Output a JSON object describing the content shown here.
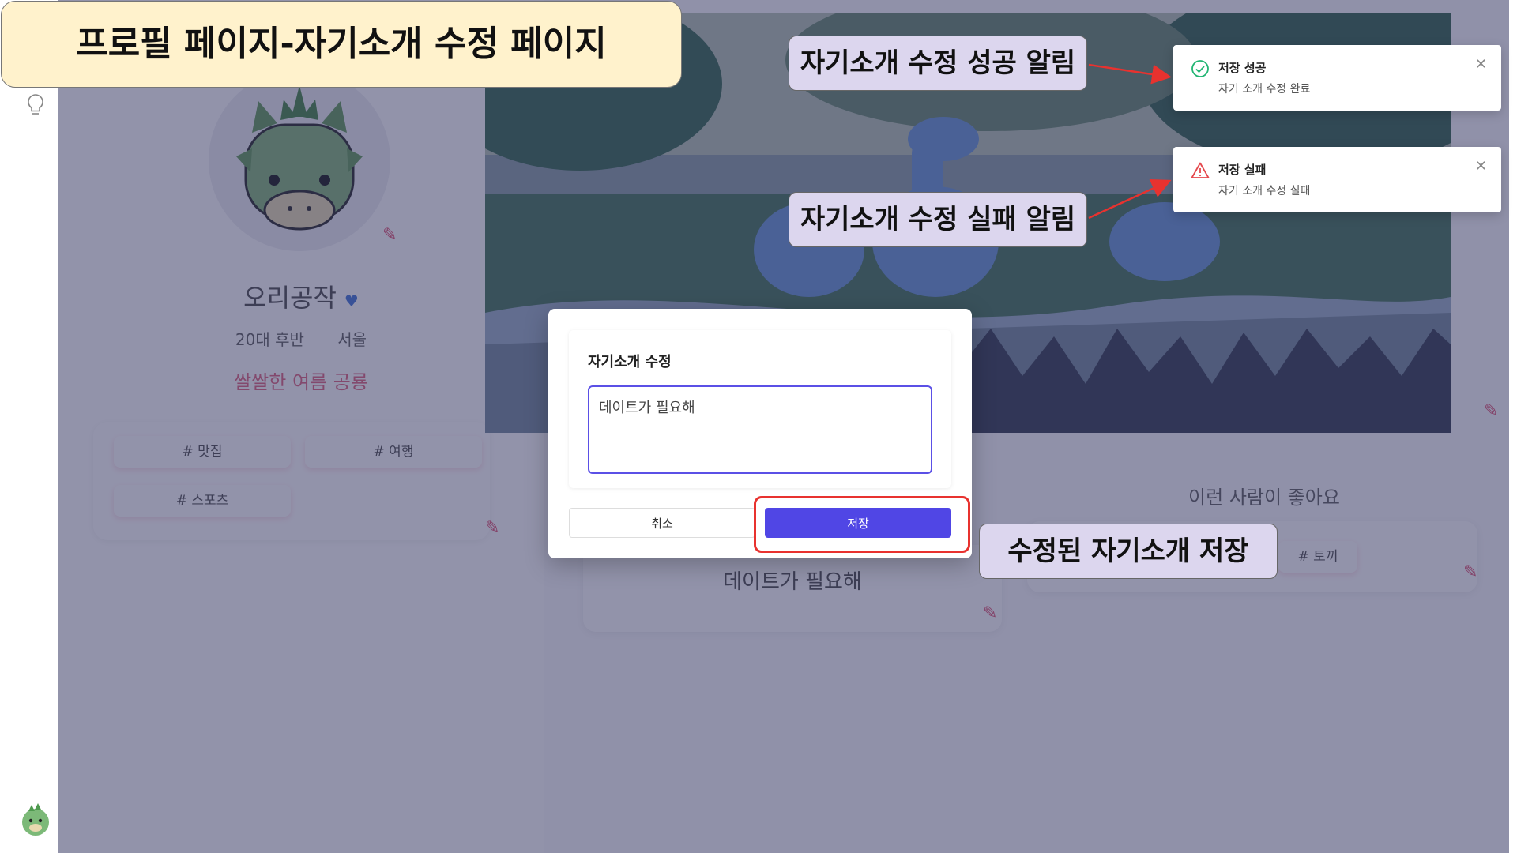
{
  "page_title": "프로필 페이지-자기소개 수정 페이지",
  "profile": {
    "nickname": "오리공작",
    "age": "20대 후반",
    "location": "서울",
    "mood": "쌀쌀한 여름 공룡",
    "tags": [
      "# 맛집",
      "# 여행",
      "# 스포츠"
    ]
  },
  "likes": {
    "title": "이런 사람이 좋아요",
    "tags": [
      "# 토끼"
    ]
  },
  "intro": {
    "text": "데이트가 필요해"
  },
  "dialog": {
    "title": "자기소개 수정",
    "value": "데이트가 필요해",
    "cancel_label": "취소",
    "save_label": "저장"
  },
  "toasts": {
    "success": {
      "title": "저장 성공",
      "message": "자기 소개 수정 완료"
    },
    "failure": {
      "title": "저장 실패",
      "message": "자기 소개 수정 실패"
    }
  },
  "callouts": {
    "success": "자기소개 수정 성공 알림",
    "failure": "자기소개 수정 실패 알림",
    "save": "수정된 자기소개 저장"
  },
  "icons": {
    "success": "check-circle-icon",
    "failure": "warning-triangle-icon",
    "close": "close-icon",
    "edit": "pencil-icon",
    "hint": "lightbulb-icon",
    "logo": "dinosaur-logo-icon"
  },
  "colors": {
    "accent": "#5046e5",
    "success": "#22b573",
    "error": "#e5484d",
    "callout_bg": "#dcd6ee",
    "title_bg": "#fff2cc",
    "highlight": "#e8322f"
  }
}
